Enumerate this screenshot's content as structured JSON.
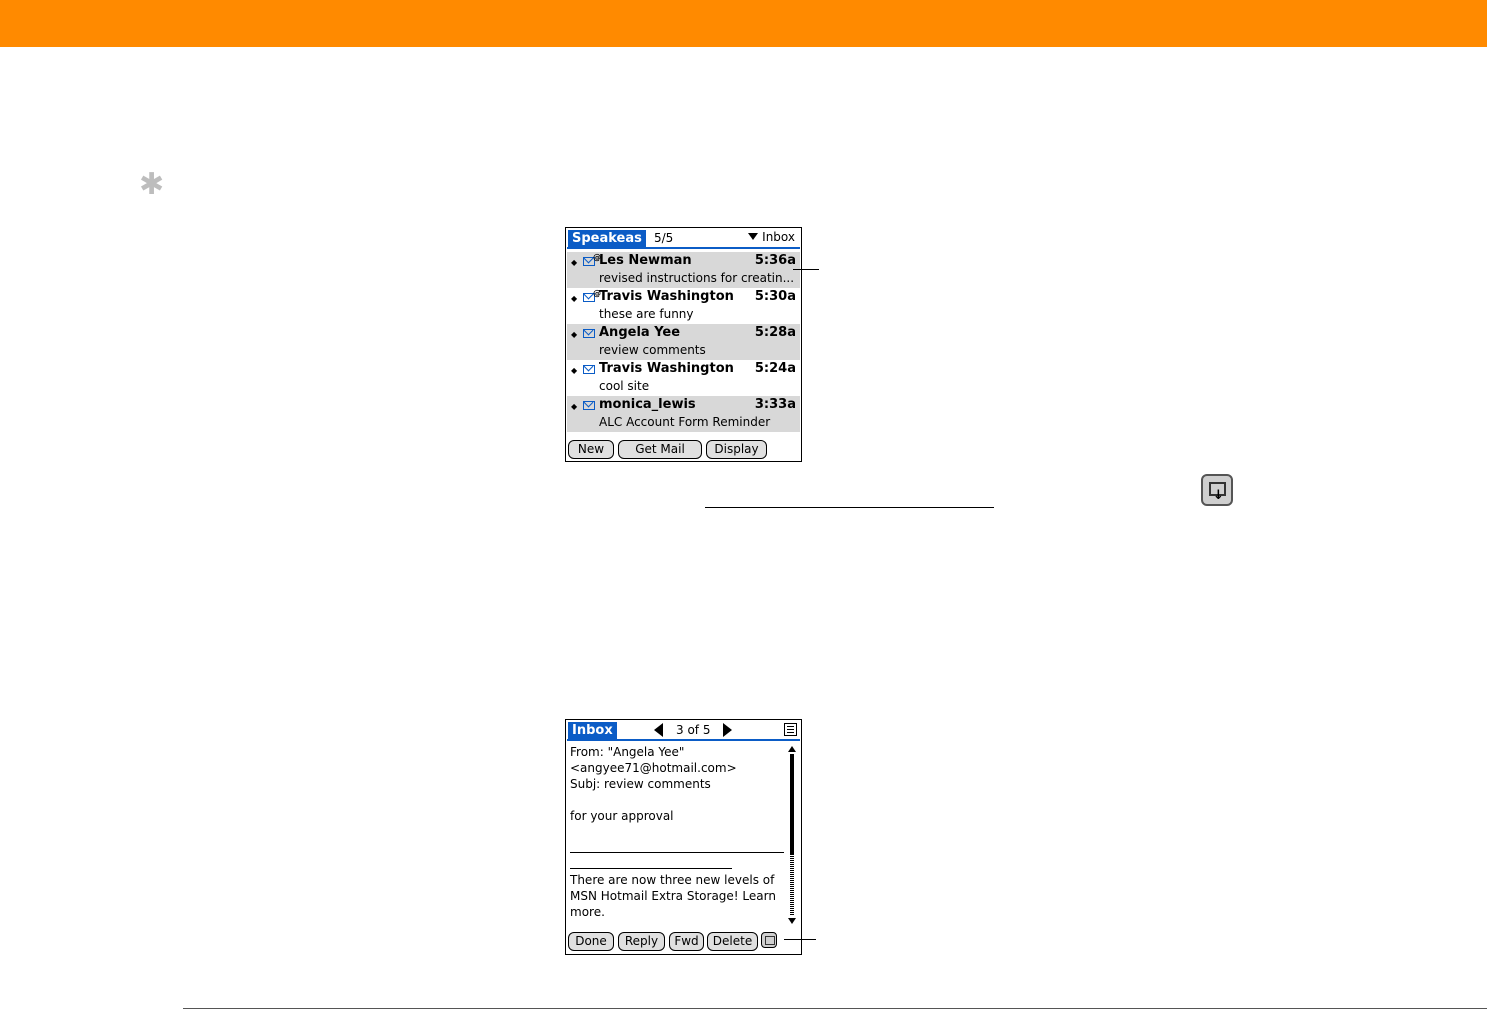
{
  "list_screen": {
    "title": "Speakeas",
    "count": "5/5",
    "folder": "Inbox",
    "messages": [
      {
        "sender": "Les Newman",
        "time": "5:36a",
        "subject": "revised instructions for creatin..."
      },
      {
        "sender": "Travis Washington",
        "time": "5:30a",
        "subject": "these are funny"
      },
      {
        "sender": "Angela Yee",
        "time": "5:28a",
        "subject": "review comments"
      },
      {
        "sender": "Travis Washington",
        "time": "5:24a",
        "subject": "cool site"
      },
      {
        "sender": "monica_lewis",
        "time": "3:33a",
        "subject": "ALC Account Form Reminder"
      }
    ],
    "buttons": {
      "new": "New",
      "get_mail": "Get Mail",
      "display": "Display"
    }
  },
  "view_screen": {
    "title": "Inbox",
    "page": "3 of 5",
    "body_lines": [
      "From:  \"Angela Yee\"",
      "<angyee71@hotmail.com>",
      " Subj:  review comments",
      "",
      "for your approval"
    ],
    "footer_lines": [
      "There are now three new levels of",
      "MSN Hotmail Extra Storage!  Learn",
      "more."
    ],
    "buttons": {
      "done": "Done",
      "reply": "Reply",
      "fwd": "Fwd",
      "delete": "Delete"
    }
  },
  "tip_symbol": "✱",
  "colors": {
    "accent_bar": "#ff8a00",
    "palm_blue": "#0b5cc6",
    "row_shade": "#d8d8d8"
  }
}
